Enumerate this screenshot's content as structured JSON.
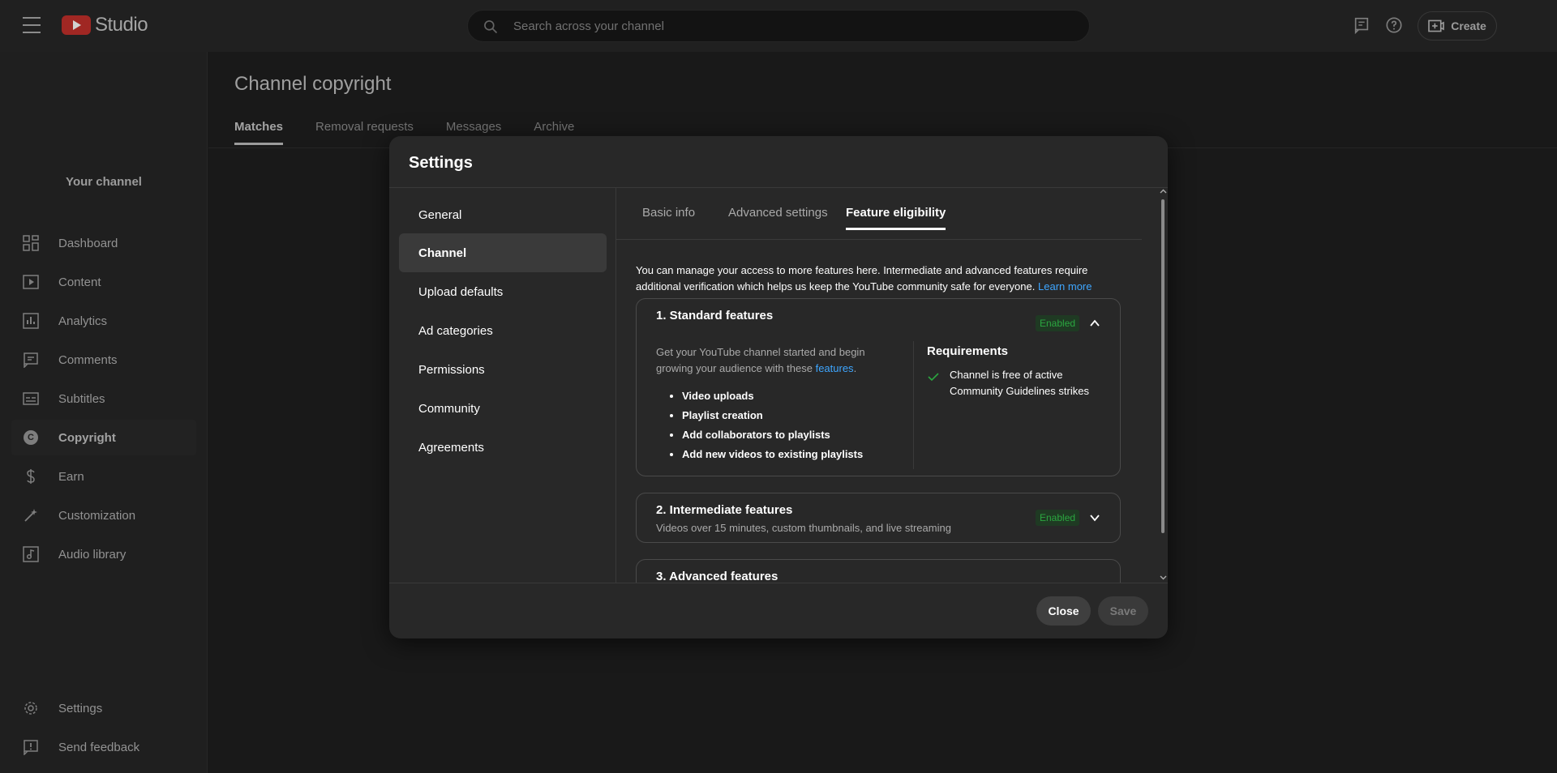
{
  "app": {
    "logo_text": "Studio",
    "brand_color": "#c4302b"
  },
  "search": {
    "placeholder": "Search across your channel"
  },
  "header": {
    "create_label": "Create"
  },
  "sidebar": {
    "channel_label": "Your channel",
    "items": [
      {
        "label": "Dashboard",
        "icon": "dashboard-icon"
      },
      {
        "label": "Content",
        "icon": "content-icon"
      },
      {
        "label": "Analytics",
        "icon": "analytics-icon"
      },
      {
        "label": "Comments",
        "icon": "comments-icon"
      },
      {
        "label": "Subtitles",
        "icon": "subtitles-icon"
      },
      {
        "label": "Copyright",
        "icon": "copyright-icon",
        "icon_glyph": "C",
        "active": true
      },
      {
        "label": "Earn",
        "icon": "dollar-icon"
      },
      {
        "label": "Customization",
        "icon": "magic-wand-icon"
      },
      {
        "label": "Audio library",
        "icon": "audio-library-icon"
      }
    ],
    "bottom": [
      {
        "label": "Settings",
        "icon": "gear-icon"
      },
      {
        "label": "Send feedback",
        "icon": "feedback-icon"
      }
    ]
  },
  "main": {
    "title": "Channel copyright",
    "tabs": [
      {
        "label": "Matches",
        "active": true
      },
      {
        "label": "Removal requests"
      },
      {
        "label": "Messages"
      },
      {
        "label": "Archive"
      }
    ]
  },
  "dialog": {
    "title": "Settings",
    "nav": [
      {
        "label": "General"
      },
      {
        "label": "Channel",
        "active": true
      },
      {
        "label": "Upload defaults"
      },
      {
        "label": "Ad categories"
      },
      {
        "label": "Permissions"
      },
      {
        "label": "Community"
      },
      {
        "label": "Agreements"
      }
    ],
    "subtabs": [
      {
        "label": "Basic info"
      },
      {
        "label": "Advanced settings"
      },
      {
        "label": "Feature eligibility",
        "active": true
      }
    ],
    "intro_text": "You can manage your access to more features here. Intermediate and advanced features require additional verification which helps us keep the YouTube community safe for everyone.",
    "learn_more": "Learn more",
    "cards": [
      {
        "title": "1. Standard features",
        "status": "Enabled",
        "expanded": true,
        "desc_prefix": "Get your YouTube channel started and begin growing your audience with these",
        "desc_link": "features",
        "desc_suffix": ".",
        "features": [
          "Video uploads",
          "Playlist creation",
          "Add collaborators to playlists",
          "Add new videos to existing playlists"
        ],
        "requirements_title": "Requirements",
        "requirements": [
          "Channel is free of active Community Guidelines strikes"
        ]
      },
      {
        "title": "2. Intermediate features",
        "status": "Enabled",
        "expanded": false,
        "subtitle": "Videos over 15 minutes, custom thumbnails, and live streaming"
      },
      {
        "title": "3. Advanced features"
      }
    ],
    "buttons": {
      "close": "Close",
      "save": "Save"
    }
  },
  "colors": {
    "enabled_green": "#2ba640",
    "link_blue": "#3ea6ff"
  }
}
